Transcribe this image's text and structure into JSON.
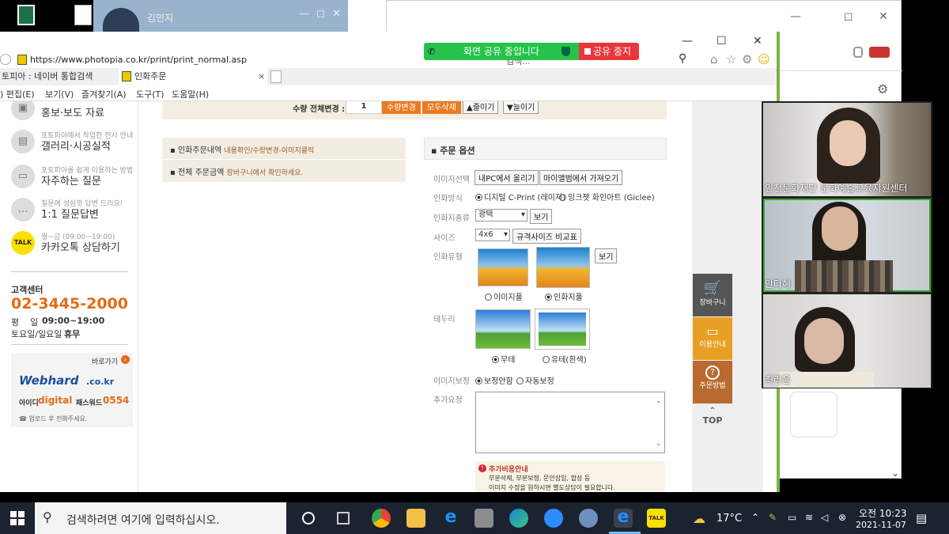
{
  "kakao_window": {
    "title": "김민지",
    "controls": [
      "—",
      "◻",
      "✕"
    ]
  },
  "back_window": {
    "controls": [
      "—",
      "◻",
      "✕"
    ]
  },
  "browser": {
    "url": "https://www.photopia.co.kr/print/print_normal.asp",
    "search_placeholder": "검색...",
    "tabs": [
      {
        "label": "토피아 : 네이버 통합검색"
      },
      {
        "label": "인화주문"
      }
    ],
    "menu": [
      ") 편집(E)",
      "보기(V)",
      "즐겨찾기(A)",
      "도구(T)",
      "도움말(H)"
    ],
    "controls": [
      "—",
      "☐",
      "✕"
    ]
  },
  "share_bar": {
    "label": "화면 공유 중입니다",
    "stop": "공유 중지"
  },
  "sidebar": {
    "items": [
      {
        "sub": "",
        "label": "홍보·보도 자료"
      },
      {
        "sub": "포토피아에서 작업한 전시 안내",
        "label": "갤러리·시공실적"
      },
      {
        "sub": "포토피아를 쉽게 이용하는 방법",
        "label": "자주하는 질문"
      },
      {
        "sub": "질문에 성심껏 답변 드리요!",
        "label": "1:1 질문답변"
      },
      {
        "sub": "월~금 (09:00~19:00)",
        "label": "카카오톡 상담하기"
      }
    ],
    "talk_badge": "TALK",
    "cs_title": "고객센터",
    "phone": "02-3445-2000",
    "weekday_label": "평    일",
    "weekday_hours": "09:00~19:00",
    "weekend_label": "토요일/일요일",
    "weekend_value": "휴무",
    "shortcut": "바로가기",
    "webhard_logo": "Webhard",
    "webhard_suffix": ".co.kr",
    "id_label": "아이디",
    "id_value": "digital",
    "pw_label": "패스워드",
    "pw_value": "0554",
    "note": "☎ 업로드 후 전화주세요."
  },
  "qty_bar": {
    "label": "수량 전체변경 :",
    "value": "1",
    "change": "수량변경",
    "delete_all": "모두삭제",
    "up": "▲줄이기",
    "down": "▼늘이기"
  },
  "order_info": {
    "row1_label": "인화주문내역",
    "row1_value": "내용확인/수량변경-이미지클릭",
    "row2_label": "전체 주문금액",
    "row2_value": "장바구니에서 확인하세요."
  },
  "options": {
    "title": "주문 옵션",
    "image_select_label": "이미지선택",
    "upload_pc": "내PC에서 올리기",
    "from_album": "마이앨범에서 가져오기",
    "print_method_label": "인화방식",
    "method_digital": "디지털 C-Print (레이저)",
    "method_inkjet": "잉크젯 화인아트 (Giclee)",
    "paper_label": "인화지종류",
    "paper_value": "광택",
    "view": "보기",
    "size_label": "사이즈",
    "size_value": "4x6",
    "compare": "규격사이즈 비교표",
    "type_label": "인화유형",
    "type_full_image": "이미지풀",
    "type_full_print": "인화지풀",
    "border_label": "테두리",
    "border_none": "무테",
    "border_white": "유테(흰색)",
    "correction_label": "이미지보정",
    "corr_none": "보정안함",
    "corr_auto": "자동보정",
    "request_label": "추가요청",
    "notice_title": "추가비용안내",
    "notice_line1": "부분삭제, 부분보정, 문안삽입, 합성 등",
    "notice_line2": "이미지 수정을 원하시면 별도상담이 필요합니다."
  },
  "float_menu": {
    "cart": "장바구니",
    "guide": "이용안내",
    "order_method": "주문방법",
    "top": "TOP"
  },
  "video": [
    {
      "name": "인천문화재단 문화예술교육지원센터"
    },
    {
      "name": "안다혜"
    },
    {
      "name": "최라윤"
    }
  ],
  "taskbar": {
    "search_placeholder": "검색하려면 여기에 입력하십시오.",
    "weather": "17°C",
    "time": "오전 10:23",
    "date": "2021-11-07"
  },
  "colors": {
    "accent_green": "#7cb342",
    "orange": "#ea7b22",
    "share_green": "#26c24a",
    "share_red": "#e8373b"
  }
}
